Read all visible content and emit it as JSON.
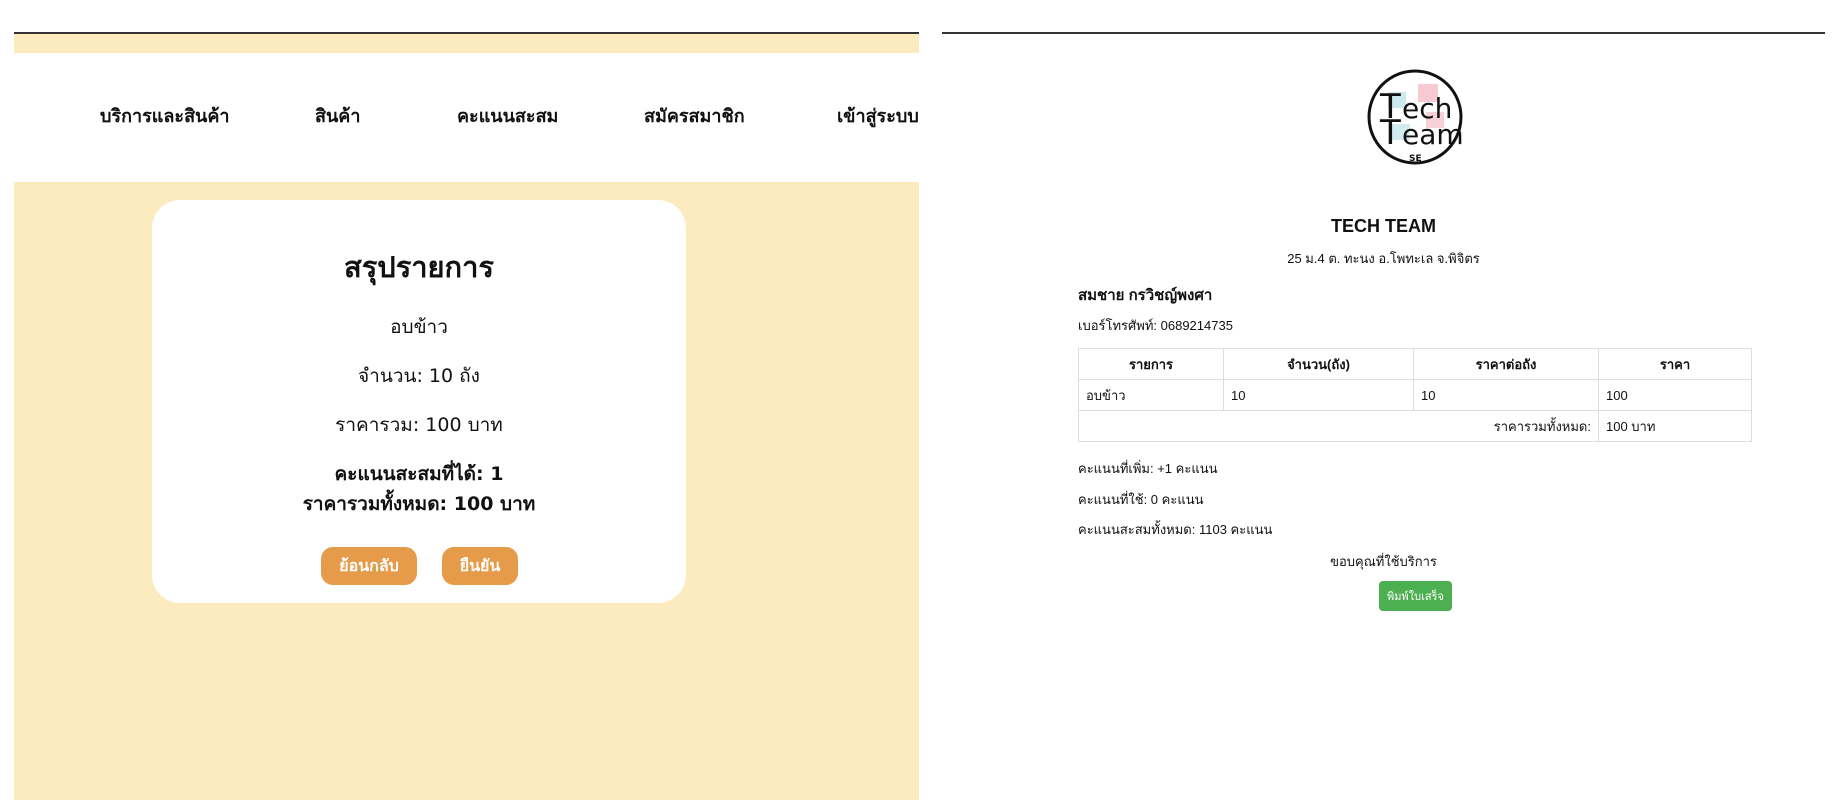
{
  "nav": {
    "items": [
      "บริการและสินค้า",
      "สินค้า",
      "คะแนนสะสม",
      "สมัครสมาชิก",
      "เข้าสู่ระบบ"
    ]
  },
  "summary": {
    "title": "สรุปรายการ",
    "product": "อบข้าว",
    "quantity": "จำนวน: 10 ถัง",
    "subtotal": "ราคารวม: 100 บาท",
    "points_earned": "คะแนนสะสมที่ได้: 1",
    "grand_total": "ราคารวมทั้งหมด: 100 บาท",
    "back_label": "ย้อนกลับ",
    "confirm_label": "ยืนยัน"
  },
  "receipt": {
    "logo": {
      "line1": "ech",
      "line2": "eam",
      "letter": "T",
      "badge": "SE"
    },
    "shop_name": "TECH TEAM",
    "shop_address": "25 ม.4 ต. ทะนง อ.โพทะเล จ.พิจิตร",
    "customer_name": "สมชาย กรวิชญ์พงศา",
    "customer_phone": "เบอร์โทรศัพท์: 0689214735",
    "table": {
      "headers": [
        "รายการ",
        "จำนวน(ถัง)",
        "ราคาต่อถัง",
        "ราคา"
      ],
      "rows": [
        [
          "อบข้าว",
          "10",
          "10",
          "100"
        ]
      ],
      "total_label": "ราคารวมทั้งหมด:",
      "total_value": "100 บาท"
    },
    "points_added": "คะแนนที่เพิ่ม: +1 คะแนน",
    "points_used": "คะแนนที่ใช้: 0 คะแนน",
    "points_total": "คะแนนสะสมทั้งหมด: 1103 คะแนน",
    "thanks": "ขอบคุณที่ใช้บริการ",
    "print_label": "พิมพ์ใบเสร็จ"
  },
  "colors": {
    "panel_bg": "#fbebbf",
    "accent_orange": "#e59b4a",
    "print_green": "#4caf50"
  }
}
